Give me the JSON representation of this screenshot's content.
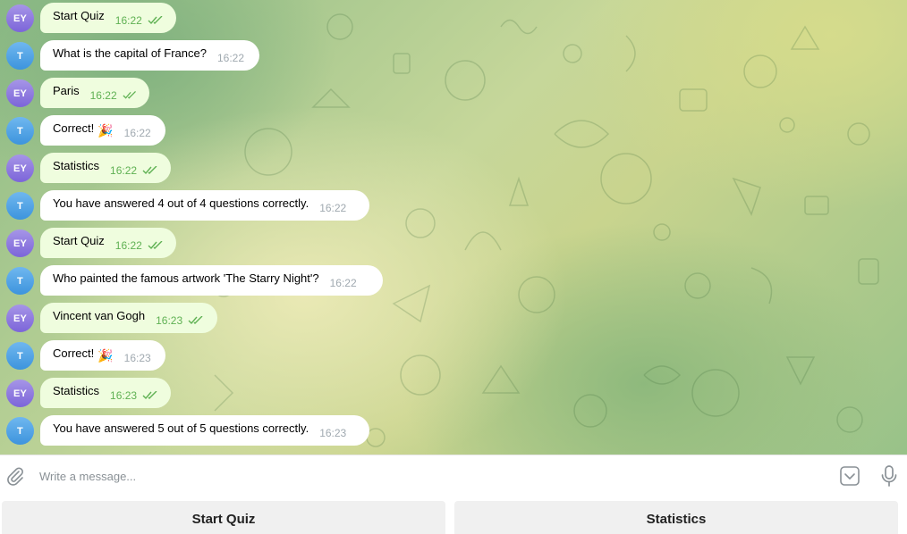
{
  "messages": [
    {
      "sender": "user",
      "avatar": "EY",
      "text": "Start Quiz",
      "time": "16:22",
      "read": true
    },
    {
      "sender": "bot",
      "avatar": "T",
      "text": "What is the capital of France?",
      "time": "16:22"
    },
    {
      "sender": "user",
      "avatar": "EY",
      "text": "Paris",
      "time": "16:22",
      "read": true
    },
    {
      "sender": "bot",
      "avatar": "T",
      "text": "Correct!",
      "emoji": "🎉",
      "time": "16:22"
    },
    {
      "sender": "user",
      "avatar": "EY",
      "text": "Statistics",
      "time": "16:22",
      "read": true
    },
    {
      "sender": "bot",
      "avatar": "T",
      "text": "You have answered 4 out of 4 questions correctly.",
      "time": "16:22"
    },
    {
      "sender": "user",
      "avatar": "EY",
      "text": "Start Quiz",
      "time": "16:22",
      "read": true
    },
    {
      "sender": "bot",
      "avatar": "T",
      "text": "Who painted the famous artwork 'The Starry Night'?",
      "time": "16:22"
    },
    {
      "sender": "user",
      "avatar": "EY",
      "text": "Vincent van Gogh",
      "time": "16:23",
      "read": true
    },
    {
      "sender": "bot",
      "avatar": "T",
      "text": "Correct!",
      "emoji": "🎉",
      "time": "16:23"
    },
    {
      "sender": "user",
      "avatar": "EY",
      "text": "Statistics",
      "time": "16:23",
      "read": true
    },
    {
      "sender": "bot",
      "avatar": "T",
      "text": "You have answered 5 out of 5 questions correctly.",
      "time": "16:23"
    }
  ],
  "composer": {
    "placeholder": "Write a message...",
    "value": ""
  },
  "keyboard": {
    "buttons": [
      "Start Quiz",
      "Statistics"
    ]
  },
  "icons": {
    "attach": "paperclip-icon",
    "keyboard_toggle": "keyboard-toggle-icon",
    "mic": "microphone-icon",
    "read_receipt": "double-check-icon"
  },
  "colors": {
    "user_bubble": "#effdde",
    "bot_bubble": "#ffffff",
    "user_time": "#5fb153",
    "bot_time": "#a0a9b0",
    "user_avatar": "#8b77df",
    "bot_avatar": "#4a9fe3"
  }
}
